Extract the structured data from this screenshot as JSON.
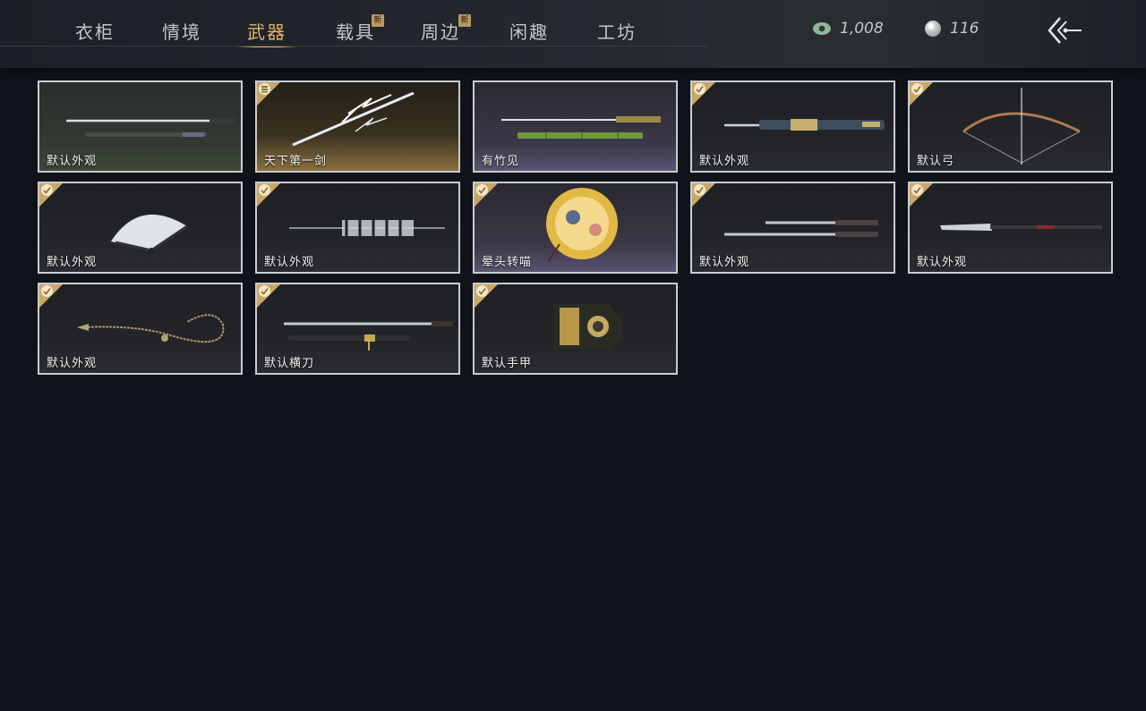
{
  "tabs": [
    {
      "label": "衣柜",
      "active": false,
      "new": false
    },
    {
      "label": "情境",
      "active": false,
      "new": false
    },
    {
      "label": "武器",
      "active": true,
      "new": false
    },
    {
      "label": "载具",
      "active": false,
      "new": true
    },
    {
      "label": "周边",
      "active": false,
      "new": true
    },
    {
      "label": "闲趣",
      "active": false,
      "new": false
    },
    {
      "label": "工坊",
      "active": false,
      "new": false
    }
  ],
  "badge_text": "新",
  "currency": {
    "jade": {
      "value": "1,008",
      "icon": "jade-coin-icon"
    },
    "pearl": {
      "value": "116",
      "icon": "pearl-icon"
    }
  },
  "back_icon": "back-arrow-icon",
  "colors": {
    "accent": "#e3b46a",
    "badge": "#b99a5e",
    "card_border": "#c9ccd0",
    "check_corner": "#c9a667"
  },
  "items": [
    {
      "label": "默认外观",
      "icon": "jian-sword-icon",
      "status": "none"
    },
    {
      "label": "天下第一剑",
      "icon": "lightning-sword-icon",
      "status": "stacked"
    },
    {
      "label": "有竹见",
      "icon": "bamboo-sword-icon",
      "status": "none"
    },
    {
      "label": "默认外观",
      "icon": "ornate-sword-icon",
      "status": "owned"
    },
    {
      "label": "默认弓",
      "icon": "bow-icon",
      "status": "owned"
    },
    {
      "label": "默认外观",
      "icon": "folding-fan-icon",
      "status": "owned"
    },
    {
      "label": "默认外观",
      "icon": "spear-icon",
      "status": "owned"
    },
    {
      "label": "晕头转喵",
      "icon": "cat-umbrella-icon",
      "status": "owned"
    },
    {
      "label": "默认外观",
      "icon": "twin-blades-icon",
      "status": "owned"
    },
    {
      "label": "默认外观",
      "icon": "glaive-icon",
      "status": "owned"
    },
    {
      "label": "默认外观",
      "icon": "rope-dart-icon",
      "status": "owned"
    },
    {
      "label": "默认横刀",
      "icon": "hengdao-icon",
      "status": "owned"
    },
    {
      "label": "默认手甲",
      "icon": "gauntlet-icon",
      "status": "owned"
    }
  ]
}
